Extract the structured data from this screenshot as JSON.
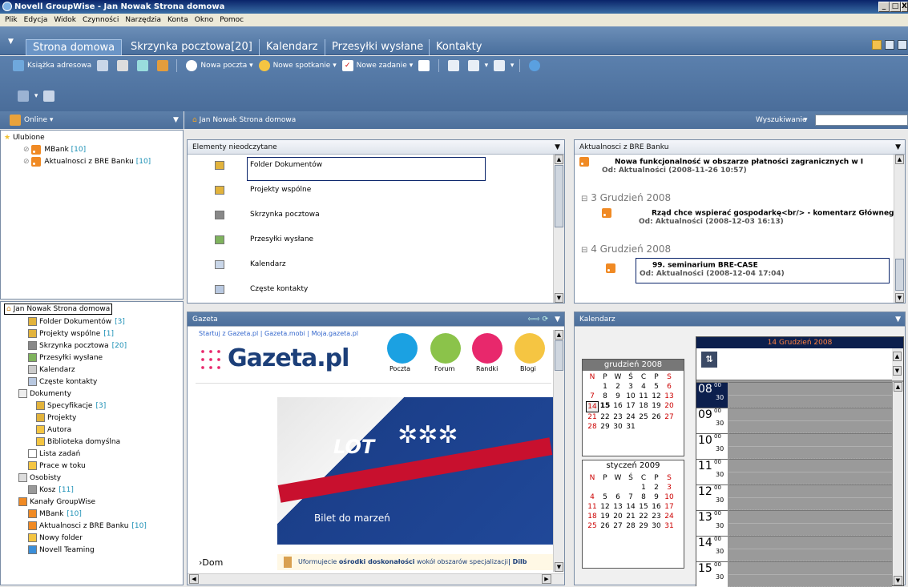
{
  "window": {
    "title": "Novell GroupWise - Jan Nowak Strona domowa",
    "min": "_",
    "max": "□",
    "close": "X"
  },
  "menu": [
    "Plik",
    "Edycja",
    "Widok",
    "Czynności",
    "Narzędzia",
    "Konta",
    "Okno",
    "Pomoc"
  ],
  "tabs": [
    {
      "label": "Strona domowa",
      "active": true
    },
    {
      "label": "Skrzynka pocztowa[20]"
    },
    {
      "label": "Kalendarz"
    },
    {
      "label": "Przesyłki wysłane"
    },
    {
      "label": "Kontakty"
    }
  ],
  "toolbar": {
    "address_book": "Książka adresowa",
    "new_mail": "Nowa poczta",
    "new_appointment": "Nowe spotkanie",
    "new_task": "Nowe zadanie"
  },
  "left_header": {
    "status": "Online"
  },
  "favorites": {
    "root": "Ulubione",
    "items": [
      {
        "label": "MBank",
        "count": "[10]"
      },
      {
        "label": "Aktualnosci z BRE Banku",
        "count": "[10]"
      }
    ]
  },
  "folder_tree": {
    "root": "Jan Nowak Strona domowa",
    "items": [
      {
        "label": "Folder Dokumentów",
        "count": "[3]"
      },
      {
        "label": "Projekty wspólne",
        "count": "[1]"
      },
      {
        "label": "Skrzynka pocztowa",
        "count": "[20]"
      },
      {
        "label": "Przesyłki wysłane",
        "count": ""
      },
      {
        "label": "Kalendarz",
        "count": ""
      },
      {
        "label": "Częste kontakty",
        "count": ""
      },
      {
        "label": "Dokumenty",
        "count": ""
      },
      {
        "label": "Specyfikacje",
        "count": "[3]"
      },
      {
        "label": "Projekty",
        "count": ""
      },
      {
        "label": "Autora",
        "count": ""
      },
      {
        "label": "Biblioteka domyślna",
        "count": ""
      },
      {
        "label": "Lista zadań",
        "count": ""
      },
      {
        "label": "Prace w toku",
        "count": ""
      },
      {
        "label": "Osobisty",
        "count": ""
      },
      {
        "label": "Kosz",
        "count": "[11]"
      },
      {
        "label": "Kanały GroupWise",
        "count": ""
      },
      {
        "label": "MBank",
        "count": "[10]"
      },
      {
        "label": "Aktualnosci z BRE Banku",
        "count": "[10]"
      },
      {
        "label": "Nowy folder",
        "count": ""
      },
      {
        "label": "Novell Teaming",
        "count": ""
      }
    ]
  },
  "main_header": {
    "title": "Jan Nowak Strona domowa",
    "search_label": "Wyszukiwanie",
    "search_value": ""
  },
  "unread_panel": {
    "title": "Elementy nieodczytane",
    "items": [
      "Folder Dokumentów",
      "Projekty wspólne",
      "Skrzynka pocztowa",
      "Przesyłki wysłane",
      "Kalendarz",
      "Częste kontakty"
    ]
  },
  "news_panel": {
    "title": "Aktualnosci z BRE Banku",
    "entries": [
      {
        "group": "",
        "headline": "Nowa funkcjonalność w obszarze płatności zagranicznych w I",
        "source": "Od: Aktualności (2008-11-26 10:57)"
      },
      {
        "group": "3 Grudzień 2008",
        "headline": "Rząd chce wspierać gospodarkę<br/> - komentarz Główneg",
        "source": "Od: Aktualności (2008-12-03 16:13)"
      },
      {
        "group": "4 Grudzień 2008",
        "headline": "99. seminarium BRE-CASE",
        "source": "Od: Aktualności (2008-12-04 17:04)"
      }
    ]
  },
  "gazeta_panel": {
    "title": "Gazeta",
    "links": "Startuj z Gazeta.pl | Gazeta.mobi | Moja.gazeta.pl",
    "logo": "Gazeta.pl",
    "icons": [
      "Poczta",
      "Forum",
      "Randki",
      "Blogi"
    ],
    "banner_brand": "LOT",
    "banner_text": "Bilet do marzeń",
    "nav": "›Dom",
    "ticker_pre": "Uformujecie ",
    "ticker_bold": "ośrodki doskonałości",
    "ticker_post": " wokół obszarów specjalizacji",
    "ticker_tail": "Dilb"
  },
  "calendar_panel": {
    "title": "Kalendarz",
    "date_heading": "14 Grudzień 2008",
    "month1": {
      "name": "grudzień 2008",
      "weekdays": [
        "N",
        "P",
        "W",
        "Ś",
        "C",
        "P",
        "S"
      ],
      "weeks": [
        [
          "",
          "1",
          "2",
          "3",
          "4",
          "5",
          "6"
        ],
        [
          "7",
          "8",
          "9",
          "10",
          "11",
          "12",
          "13"
        ],
        [
          "14",
          "15",
          "16",
          "17",
          "18",
          "19",
          "20"
        ],
        [
          "21",
          "22",
          "23",
          "24",
          "25",
          "26",
          "27"
        ],
        [
          "28",
          "29",
          "30",
          "31",
          "",
          "",
          ""
        ]
      ]
    },
    "month2": {
      "name": "styczeń 2009",
      "weekdays": [
        "N",
        "P",
        "W",
        "Ś",
        "C",
        "P",
        "S"
      ],
      "weeks": [
        [
          "",
          "",
          "",
          "",
          "1",
          "2",
          "3"
        ],
        [
          "4",
          "5",
          "6",
          "7",
          "8",
          "9",
          "10"
        ],
        [
          "11",
          "12",
          "13",
          "14",
          "15",
          "16",
          "17"
        ],
        [
          "18",
          "19",
          "20",
          "21",
          "22",
          "23",
          "24"
        ],
        [
          "25",
          "26",
          "27",
          "28",
          "29",
          "30",
          "31"
        ]
      ]
    },
    "hours": [
      "08",
      "09",
      "10",
      "11",
      "12",
      "13",
      "14",
      "15"
    ],
    "minute_top": "00",
    "minute_half": "30"
  }
}
